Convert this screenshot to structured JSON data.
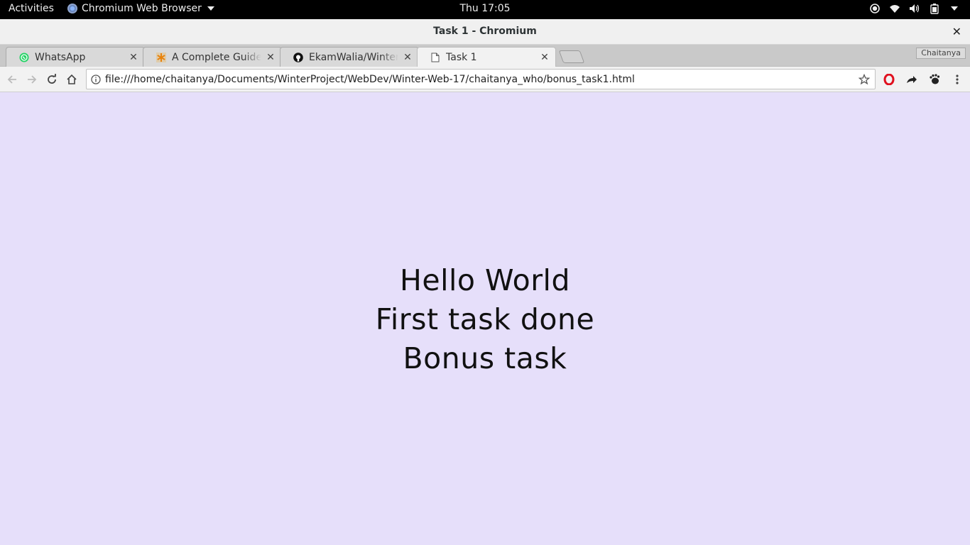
{
  "topbar": {
    "activities": "Activities",
    "app_name": "Chromium Web Browser",
    "clock": "Thu 17:05"
  },
  "window": {
    "title": "Task 1 - Chromium"
  },
  "tabs": [
    {
      "title": "WhatsApp",
      "icon": "whatsapp-icon"
    },
    {
      "title": "A Complete Guide to",
      "icon": "asterisk-icon"
    },
    {
      "title": "EkamWalia/Winter-W",
      "icon": "github-icon"
    },
    {
      "title": "Task 1",
      "icon": "page-icon",
      "active": true
    }
  ],
  "profile": "Chaitanya",
  "omnibox": {
    "url": "file:///home/chaitanya/Documents/WinterProject/WebDev/Winter-Web-17/chaitanya_who/bonus_task1.html"
  },
  "page": {
    "lines": [
      "Hello World",
      "First task done",
      "Bonus task"
    ],
    "background": "#e6dffa"
  }
}
